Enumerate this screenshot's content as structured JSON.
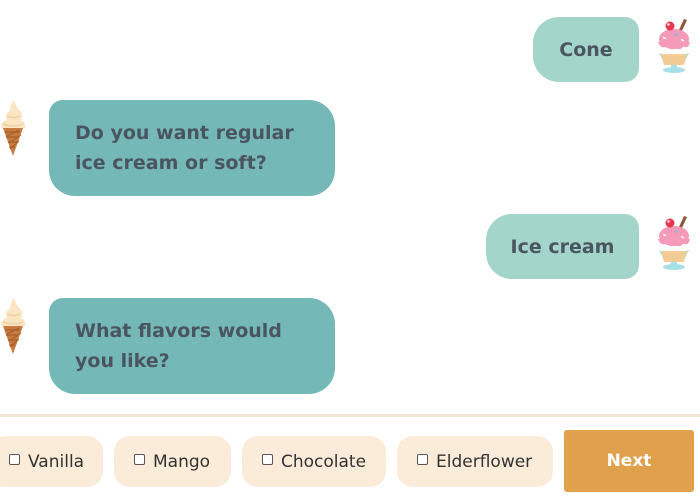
{
  "messages": [
    {
      "sender": "user",
      "text": "Cone"
    },
    {
      "sender": "bot",
      "text": "Do you want regular ice cream or soft?"
    },
    {
      "sender": "user",
      "text": "Ice cream"
    },
    {
      "sender": "bot",
      "text": "What flavors would you like?"
    }
  ],
  "options": [
    {
      "label": "Vanilla",
      "checked": false
    },
    {
      "label": "Mango",
      "checked": false
    },
    {
      "label": "Chocolate",
      "checked": false
    },
    {
      "label": "Elderflower",
      "checked": false
    }
  ],
  "next_label": "Next",
  "icons": {
    "user_avatar": "ice-cream-sundae-icon",
    "bot_avatar": "soft-serve-cone-icon"
  },
  "colors": {
    "user_bubble": "#a3d5ca",
    "bot_bubble": "#75b8b8",
    "option_bg": "#fbebd9",
    "next_button": "#e0a04c",
    "text": "#4a5560"
  }
}
